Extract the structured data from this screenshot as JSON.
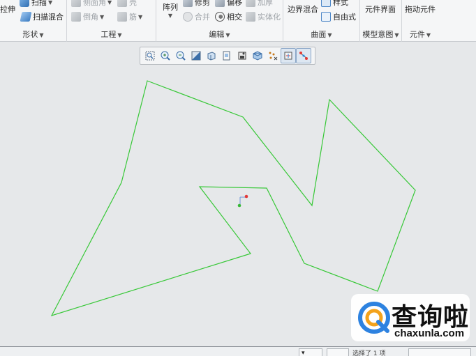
{
  "ribbon": {
    "groups": [
      {
        "label": "形状"
      },
      {
        "label": "工程"
      },
      {
        "label": "编辑"
      },
      {
        "label": "曲面"
      },
      {
        "label": "模型意图"
      },
      {
        "label": "元件"
      }
    ],
    "shape": {
      "extrude": "拉伸",
      "sweep": "扫描",
      "swept_blend": "扫描混合"
    },
    "engineering": {
      "side_face": "侧面角",
      "round": "倒角",
      "hole": "壳",
      "rib": "筋"
    },
    "editing": {
      "pattern": "阵列",
      "trim": "修剪",
      "merge": "合并",
      "offset": "偏移",
      "intersect": "相交",
      "thicken": "加厚",
      "solidify": "实体化"
    },
    "surfaces": {
      "boundary_blend": "边界混合",
      "style": "样式",
      "freestyle": "自由式"
    },
    "model_intent": {
      "component_interface": "元件界面"
    },
    "component": {
      "drag_components": "拖动元件"
    }
  },
  "view_toolbar": {
    "buttons": [
      {
        "icon": "zoom-fit-icon",
        "active": false
      },
      {
        "icon": "zoom-in-icon",
        "active": false
      },
      {
        "icon": "zoom-out-icon",
        "active": false
      },
      {
        "icon": "repaint-icon",
        "active": false
      },
      {
        "icon": "display-style-icon",
        "active": false
      },
      {
        "icon": "saved-views-icon",
        "active": false
      },
      {
        "icon": "view-manager-icon",
        "active": false
      },
      {
        "icon": "perspective-icon",
        "active": false
      },
      {
        "icon": "datum-display-icon",
        "active": false
      },
      {
        "icon": "spin-center-icon",
        "active": true
      },
      {
        "icon": "annotation-display-icon",
        "active": true
      }
    ]
  },
  "canvas": {
    "sketch_color": "#37c837",
    "background": "#e6e8ea"
  },
  "status_bar": {
    "selection_text": "选择了 1 项"
  },
  "watermark": {
    "title": "查询啦",
    "subtitle": "chaxunla.com"
  },
  "colors": {
    "accent": "#3d7fd1",
    "logo_orange": "#f3a21b",
    "logo_blue": "#2d82e0"
  }
}
